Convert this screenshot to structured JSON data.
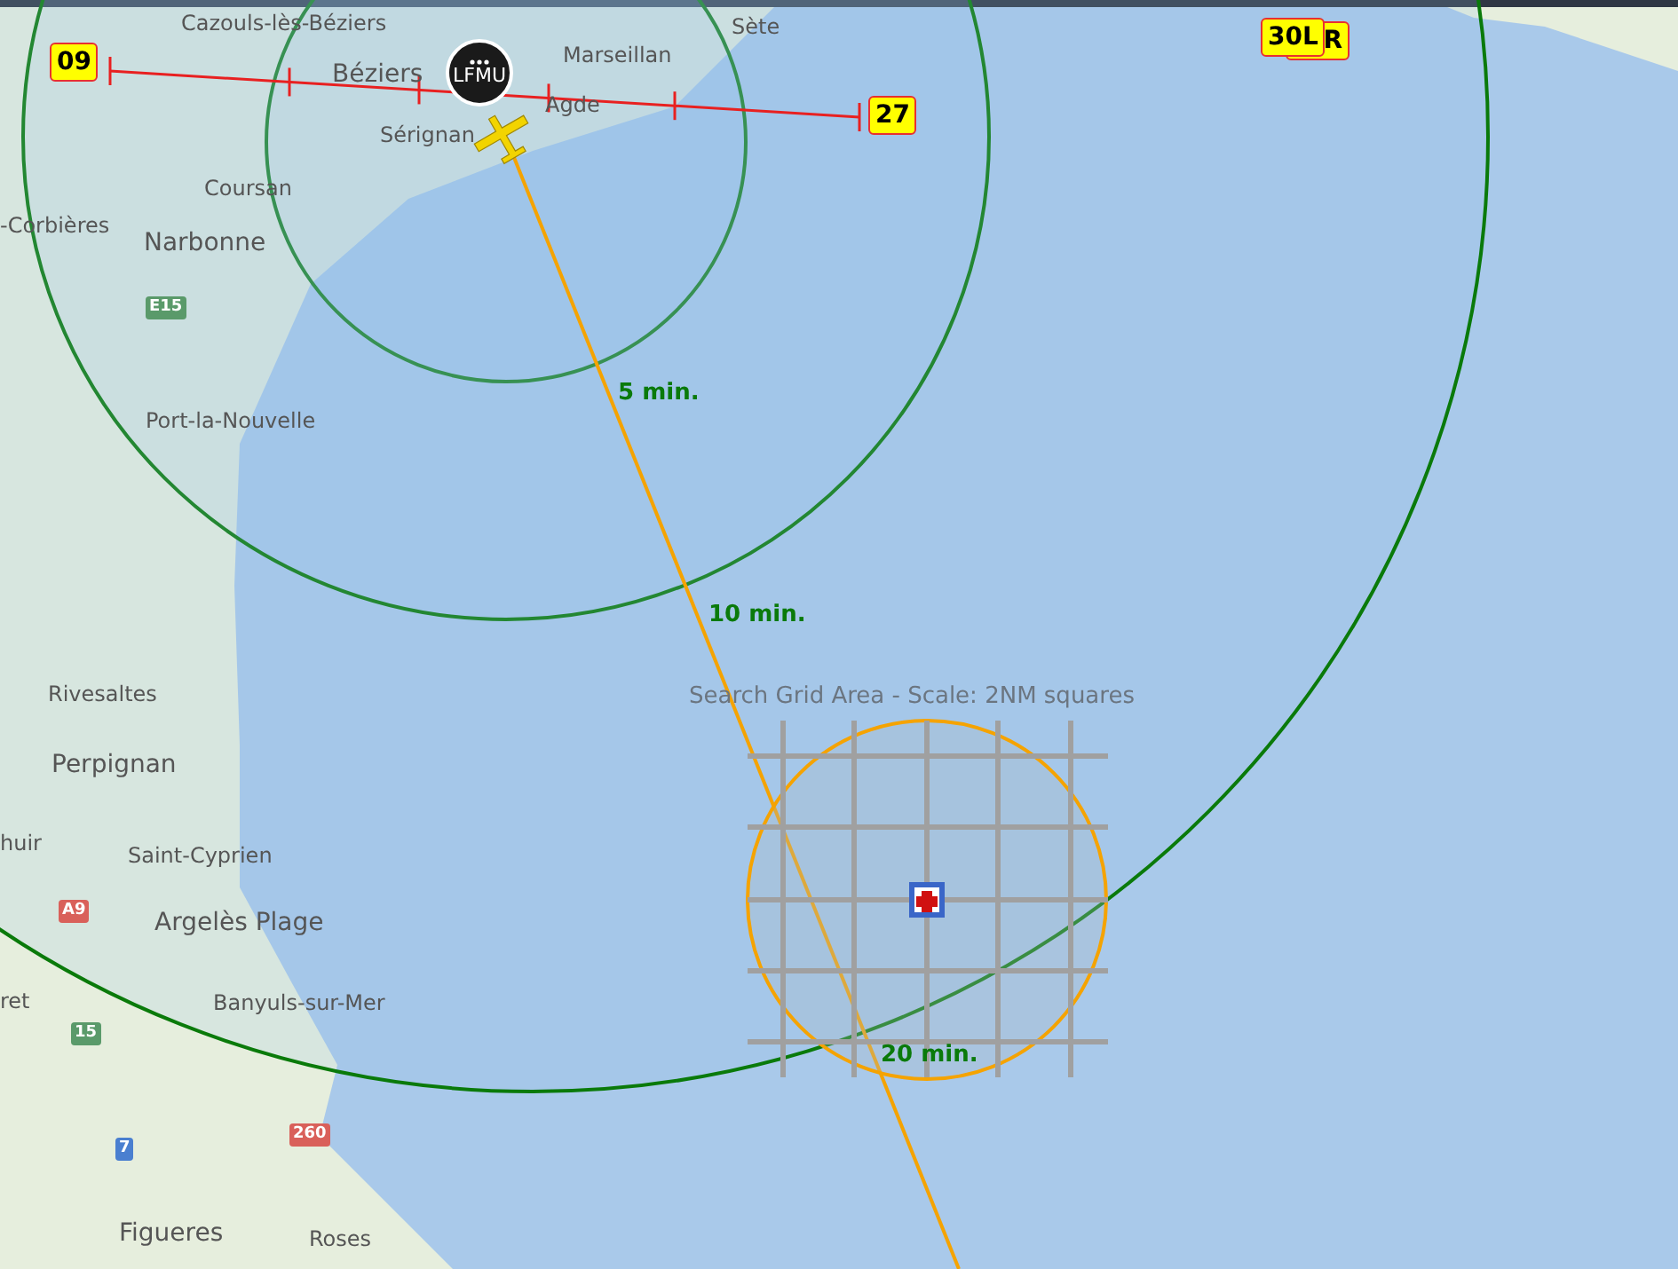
{
  "places": [
    "Cazouls-lès-Béziers",
    "Sète",
    "Marseillan",
    "Béziers",
    "Agde",
    "Sérignan",
    "Coursan",
    "-Corbières",
    "Narbonne",
    "Port-la-Nouvelle",
    "Rivesaltes",
    "Perpignan",
    "huir",
    "Saint-Cyprien",
    "Argelès Plage",
    "ret",
    "Banyuls-sur-Mer",
    "Figueres",
    "Roses"
  ],
  "road_shields": [
    {
      "label": "E15",
      "color": "#5a9a6a"
    },
    {
      "label": "A9",
      "color": "#d9605a"
    },
    {
      "label": "15",
      "color": "#5a9a6a"
    },
    {
      "label": "7",
      "color": "#4a7fd0"
    },
    {
      "label": "260",
      "color": "#d9605a"
    }
  ],
  "runway_labels": [
    "09",
    "27",
    "R",
    "30L"
  ],
  "airport": {
    "code": "LFMU"
  },
  "range_rings": [
    "5 min.",
    "10 min.",
    "20 min."
  ],
  "search_grid": {
    "title": "Search Grid Area - Scale: 2NM squares"
  }
}
